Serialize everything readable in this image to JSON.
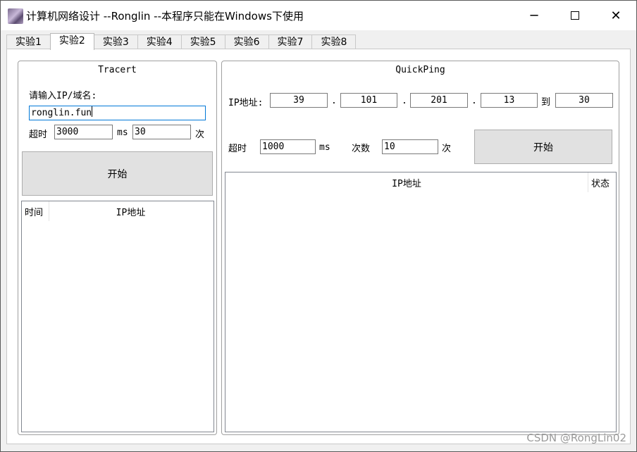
{
  "window": {
    "title": "计算机网络设计 --Ronglin  --本程序只能在Windows下使用",
    "icon": "app-icon",
    "controls": {
      "minimize": "─",
      "close": "✕"
    }
  },
  "tabs": [
    "实验1",
    "实验2",
    "实验3",
    "实验4",
    "实验5",
    "实验6",
    "实验7",
    "实验8"
  ],
  "active_tab": "实验2",
  "tracert": {
    "title": "Tracert",
    "prompt": "请输入IP/域名:",
    "host_value": "ronglin.fun",
    "timeout_label": "超时",
    "timeout_value": "3000",
    "ms_label": "ms",
    "count_value": "30",
    "count_unit": "次",
    "start_label": "开始",
    "columns": [
      "时间",
      "IP地址"
    ]
  },
  "quickping": {
    "title": "QuickPing",
    "ip_label": "IP地址:",
    "octets": [
      "39",
      "101",
      "201",
      "13"
    ],
    "dot": ".",
    "to_label": "到",
    "end_value": "30",
    "timeout_label": "超时",
    "timeout_value": "1000",
    "ms_label": "ms",
    "count_label": "次数",
    "count_value": "10",
    "count_unit": "次",
    "start_label": "开始",
    "columns": [
      "IP地址",
      "状态"
    ]
  },
  "watermark": "CSDN @RongLin02"
}
